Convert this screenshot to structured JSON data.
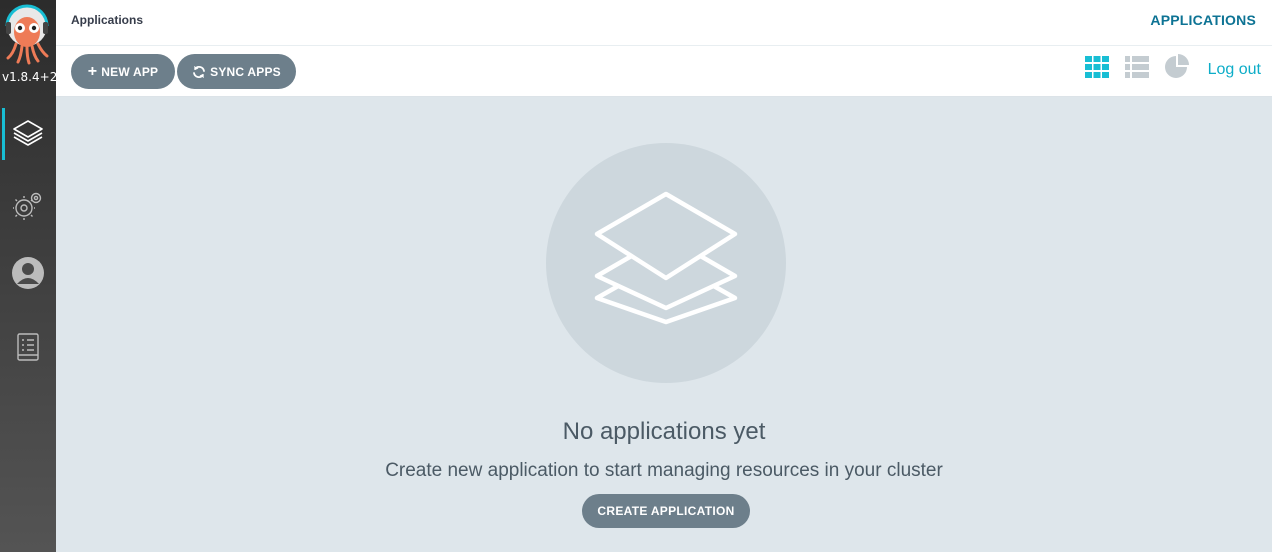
{
  "sidebar": {
    "version": "v1.8.4+2",
    "items": [
      {
        "name": "applications",
        "icon": "layers-icon",
        "active": true
      },
      {
        "name": "settings",
        "icon": "gears-icon",
        "active": false
      },
      {
        "name": "user-info",
        "icon": "user-circle-icon",
        "active": false
      },
      {
        "name": "documentation",
        "icon": "book-icon",
        "active": false
      }
    ]
  },
  "header": {
    "breadcrumb": "Applications",
    "title": "APPLICATIONS"
  },
  "toolbar": {
    "new_app_label": "NEW APP",
    "sync_apps_label": "SYNC APPS",
    "logout_label": "Log out",
    "views": [
      "tiles-view-icon",
      "list-view-icon",
      "summary-pie-icon"
    ],
    "active_view": "tiles-view-icon"
  },
  "empty_state": {
    "title": "No applications yet",
    "description": "Create new application to start managing resources in your cluster",
    "create_label": "CREATE APPLICATION"
  },
  "colors": {
    "accent": "#18bed4",
    "header_title": "#0d7394",
    "button": "#6d7f8b",
    "background": "#dee6eb"
  }
}
